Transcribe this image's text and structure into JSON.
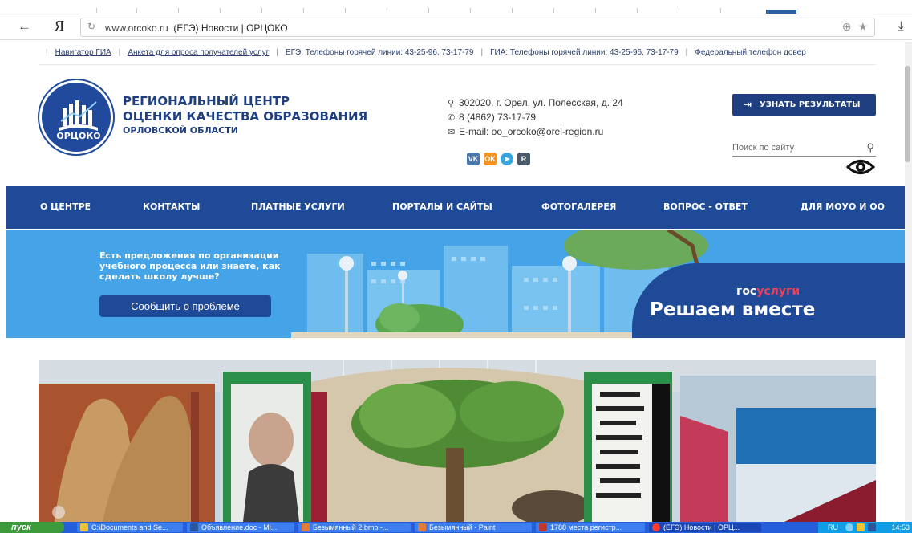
{
  "browser": {
    "brand_letter": "Я",
    "url_domain": "www.orcoko.ru",
    "url_title": "(ЕГЭ) Новости | ОРЦОКО",
    "icons": [
      "back-arrow-icon",
      "reload-icon",
      "protect-icon",
      "bookmark-star-icon",
      "download-icon"
    ]
  },
  "top_links": [
    {
      "label": "Навигатор ГИА",
      "link": true
    },
    {
      "label": "Анкета для опроса получателей услуг",
      "link": true
    },
    {
      "label": "ЕГЭ: Телефоны горячей линии: 43-25-96, 73-17-79",
      "link": false
    },
    {
      "label": "ГИА: Телефоны горячей линии: 43-25-96, 73-17-79",
      "link": false
    },
    {
      "label": "Федеральный телефон довер",
      "link": false
    }
  ],
  "org": {
    "logo_text": "ОРЦОКО",
    "name_line1": "РЕГИОНАЛЬНЫЙ ЦЕНТР",
    "name_line2": "ОЦЕНКИ КАЧЕСТВА ОБРАЗОВАНИЯ",
    "name_line3": "ОРЛОВСКОЙ ОБЛАСТИ"
  },
  "contacts": {
    "address": "302020, г. Орел, ул. Полесская, д. 24",
    "phone": "8 (4862) 73-17-79",
    "email": "E-mail: oo_orcoko@orel-region.ru"
  },
  "social": [
    {
      "name": "vk-icon",
      "glyph": "VK"
    },
    {
      "name": "odnoklassniki-icon",
      "glyph": "OK"
    },
    {
      "name": "telegram-icon",
      "glyph": "➤"
    },
    {
      "name": "rutube-icon",
      "glyph": "R"
    }
  ],
  "header_actions": {
    "results_label": "УЗНАТЬ РЕЗУЛЬТАТЫ",
    "search_placeholder": "Поиск по сайту"
  },
  "nav": [
    "О ЦЕНТРЕ",
    "КОНТАКТЫ",
    "ПЛАТНЫЕ УСЛУГИ",
    "ПОРТАЛЫ И САЙТЫ",
    "ФОТОГАЛЕРЕЯ",
    "ВОПРОС - ОТВЕТ",
    "ДЛЯ МОУО И ОО"
  ],
  "banner": {
    "text": "Есть предложения по организации учебного процесса или знаете, как сделать школу лучше?",
    "button": "Сообщить о проблеме",
    "gos_part1": "гос",
    "gos_part2": "услуги",
    "title": "Решаем вместе"
  },
  "taskbar": {
    "start": "пуск",
    "tasks": [
      "C:\\Documents and Se...",
      "Объявление.doc - Mi...",
      "Безымянный 2.bmp -...",
      "Безымянный - Paint",
      "1788 места регистр...",
      "(ЕГЭ) Новости | ОРЦ..."
    ],
    "lang": "RU",
    "clock": "14:53"
  },
  "colors": {
    "brand_blue": "#1f4a98",
    "banner_blue": "#44a4e7",
    "gos_red": "#ee3f58"
  }
}
